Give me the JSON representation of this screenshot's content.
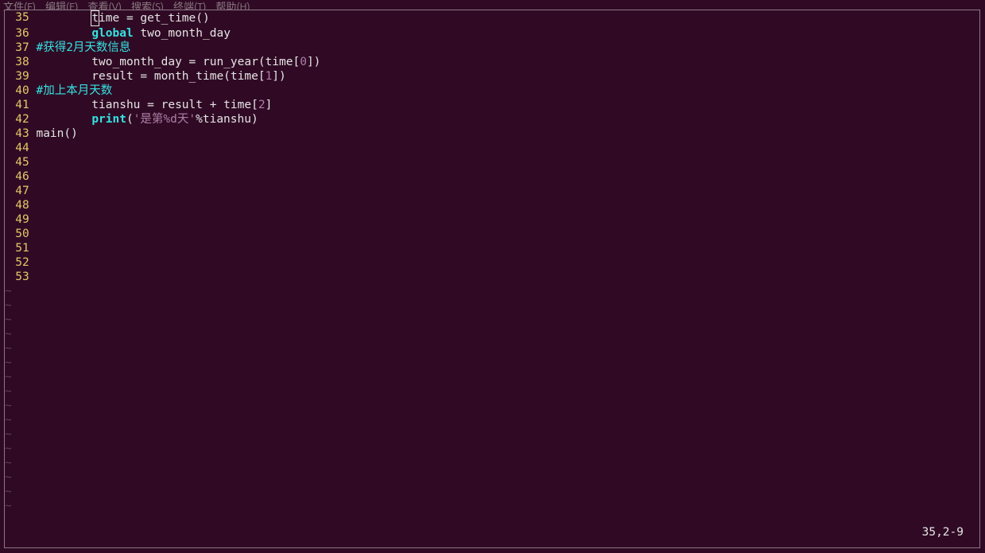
{
  "menu": {
    "file": "文件(F)",
    "edit": "编辑(E)",
    "view": "查看(V)",
    "search": "搜索(S)",
    "terminal": "终端(T)",
    "help": "帮助(H)"
  },
  "status_line": "35,2-9",
  "lines": {
    "ln35": "35",
    "ln36": "36",
    "ln37": "37",
    "ln38": "38",
    "ln39": "39",
    "ln40": "40",
    "ln41": "41",
    "ln42": "42",
    "ln43": "43",
    "ln44": "44",
    "ln45": "45",
    "ln46": "46",
    "ln47": "47",
    "ln48": "48",
    "ln49": "49",
    "ln50": "50",
    "ln51": "51",
    "ln52": "52",
    "ln53": "53"
  },
  "code": {
    "l35_a": "ime = get_time()",
    "l35_cursor": "t",
    "l35_indent": "        ",
    "l36_indent": "        ",
    "l36_kw": "global",
    "l36_rest": " two_month_day",
    "l37_cmt": "#获得2月天数信息",
    "l38": "        two_month_day = run_year(time[",
    "l38_num": "0",
    "l38_end": "])",
    "l39": "        result = month_time(time[",
    "l39_num": "1",
    "l39_end": "])",
    "l40_cmt": "#加上本月天数",
    "l41": "        tianshu = result + time[",
    "l41_num": "2",
    "l41_end": "]",
    "l42_indent": "        ",
    "l42_kw": "print",
    "l42_a": "(",
    "l42_str": "'是第%d天'",
    "l42_b": "%tianshu)",
    "l43": "main()"
  },
  "tilde": "~"
}
